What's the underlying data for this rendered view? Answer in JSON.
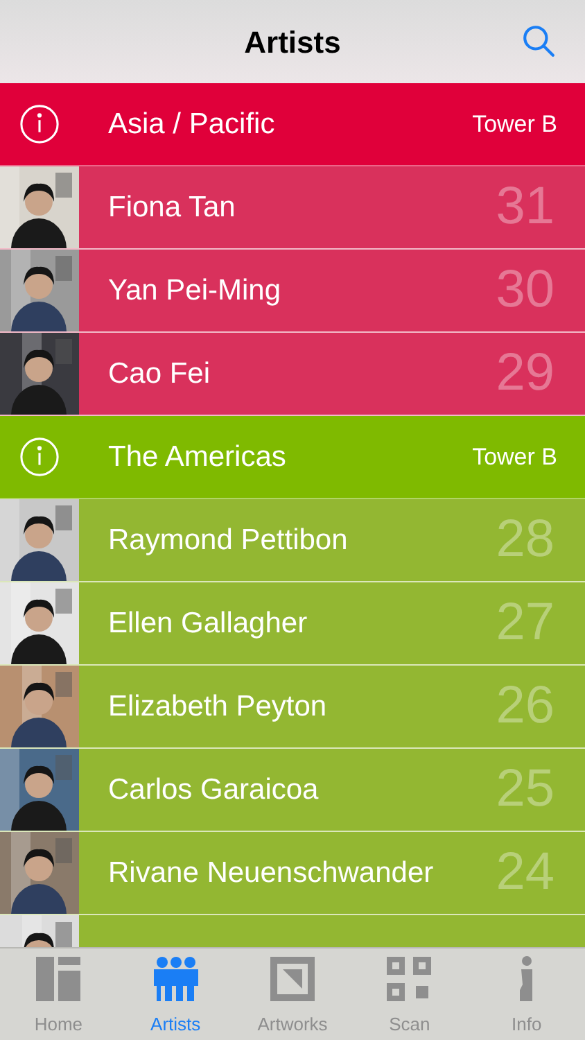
{
  "nav": {
    "title": "Artists"
  },
  "sections": [
    {
      "title": "Asia / Pacific",
      "location": "Tower B",
      "color": "#e0003a",
      "artists": [
        {
          "kind": "artist",
          "name": "Fiona Tan",
          "number": "31"
        },
        {
          "kind": "artist",
          "name": "Yan Pei-Ming",
          "number": "30"
        },
        {
          "kind": "artist",
          "name": "Cao Fei",
          "number": "29"
        }
      ]
    },
    {
      "title": "The Americas",
      "location": "Tower B",
      "color": "#7fba00",
      "artists": [
        {
          "kind": "artist",
          "name": "Raymond Pettibon",
          "number": "28"
        },
        {
          "kind": "artist",
          "name": "Ellen Gallagher",
          "number": "27"
        },
        {
          "kind": "artist",
          "name": "Elizabeth Peyton",
          "number": "26"
        },
        {
          "kind": "artist",
          "name": "Carlos Garaicoa",
          "number": "25"
        },
        {
          "kind": "artist",
          "name": "Rivane Neuenschwander",
          "number": "24"
        },
        {
          "kind": "partial"
        }
      ]
    }
  ],
  "tabs": [
    {
      "label": "Home",
      "kind": "home",
      "selected": false
    },
    {
      "label": "Artists",
      "kind": "artists",
      "selected": true
    },
    {
      "label": "Artworks",
      "kind": "artworks",
      "selected": false
    },
    {
      "label": "Scan",
      "kind": "scan",
      "selected": false
    },
    {
      "label": "Info",
      "kind": "info",
      "selected": false
    }
  ]
}
